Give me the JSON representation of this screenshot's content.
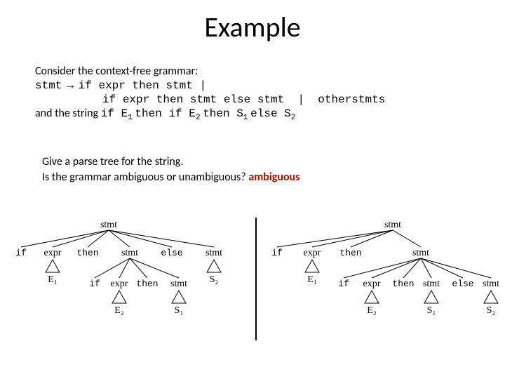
{
  "title": "Example",
  "grammar": {
    "intro": "Consider the context-free grammar:",
    "line1_a": "stmt",
    "line1_arrow": "→",
    "line1_b": " if expr then stmt |",
    "line2": "          if expr then stmt else stmt  |  otherstmts",
    "line3_a": "and the string ",
    "line3_code_1": "if E",
    "line3_sub1": "1",
    "line3_code_2": " then  if E",
    "line3_sub2": "2",
    "line3_code_3": " then S",
    "line3_sub3": "1",
    "line3_code_4": " else  S",
    "line3_sub4": "2"
  },
  "questions": {
    "q1": "Give a parse tree for the string.",
    "q2a": "Is the grammar ambiguous or unambiguous? ",
    "q2_answer": "ambiguous"
  },
  "tree_labels": {
    "stmt": "stmt",
    "if": "if",
    "expr": "expr",
    "then": "then",
    "else": "else",
    "E1": "E₁",
    "E2": "E₂",
    "S1": "S₁",
    "S2": "S₂"
  }
}
